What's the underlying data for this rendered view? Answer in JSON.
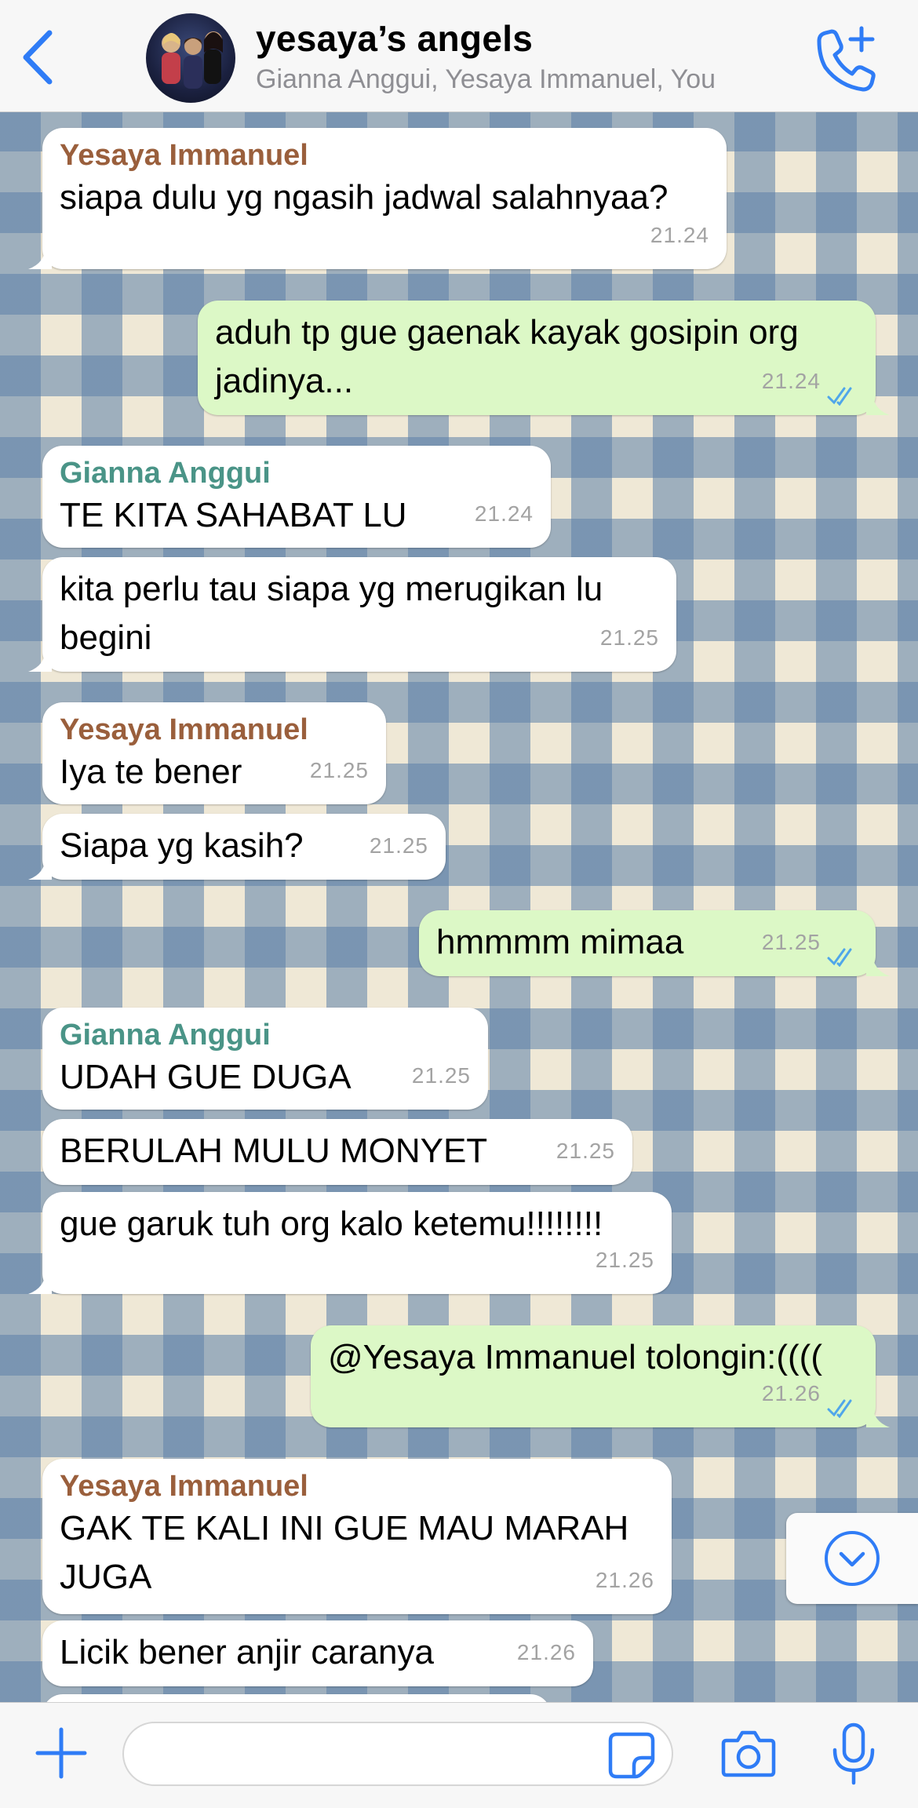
{
  "header": {
    "title": "yesaya’s angels",
    "subtitle": "Gianna Anggui, Yesaya Immanuel, You"
  },
  "colors": {
    "accent": "#2f7cf6",
    "sender_yesaya": "#9a5f3c",
    "sender_gianna": "#4a9487",
    "bubble_in": "#ffffff",
    "bubble_out": "#dcf8c6"
  },
  "messages": [
    {
      "sender": "Yesaya Immanuel",
      "text": "siapa dulu yg ngasih jadwal salahnyaa?",
      "time": "21.24"
    },
    {
      "text": "aduh tp gue gaenak kayak gosipin org jadinya...",
      "time": "21.24"
    },
    {
      "sender": "Gianna Anggui",
      "text": "TE KITA SAHABAT LU",
      "time": "21.24"
    },
    {
      "text": "kita perlu tau siapa yg merugikan lu begini",
      "time": "21.25"
    },
    {
      "sender": "Yesaya Immanuel",
      "text": "Iya te bener",
      "time": "21.25"
    },
    {
      "text": "Siapa yg kasih?",
      "time": "21.25"
    },
    {
      "text": "hmmmm mimaa",
      "time": "21.25"
    },
    {
      "sender": "Gianna Anggui",
      "text": "UDAH GUE DUGA",
      "time": "21.25"
    },
    {
      "text": "BERULAH MULU MONYET",
      "time": "21.25"
    },
    {
      "text": "gue garuk tuh org kalo ketemu!!!!!!!!",
      "time": "21.25"
    },
    {
      "text": "@Yesaya Immanuel tolongin:((((",
      "time": "21.26"
    },
    {
      "sender": "Yesaya Immanuel",
      "text": "GAK TE KALI INI GUE MAU MARAH JUGA",
      "time": "21.26"
    },
    {
      "text": "Licik bener anjir caranya",
      "time": "21.26"
    }
  ],
  "composer": {
    "placeholder": ""
  },
  "icons": [
    "back-chevron",
    "add-call",
    "scroll-down-chevron",
    "plus",
    "sticker",
    "camera",
    "microphone"
  ]
}
